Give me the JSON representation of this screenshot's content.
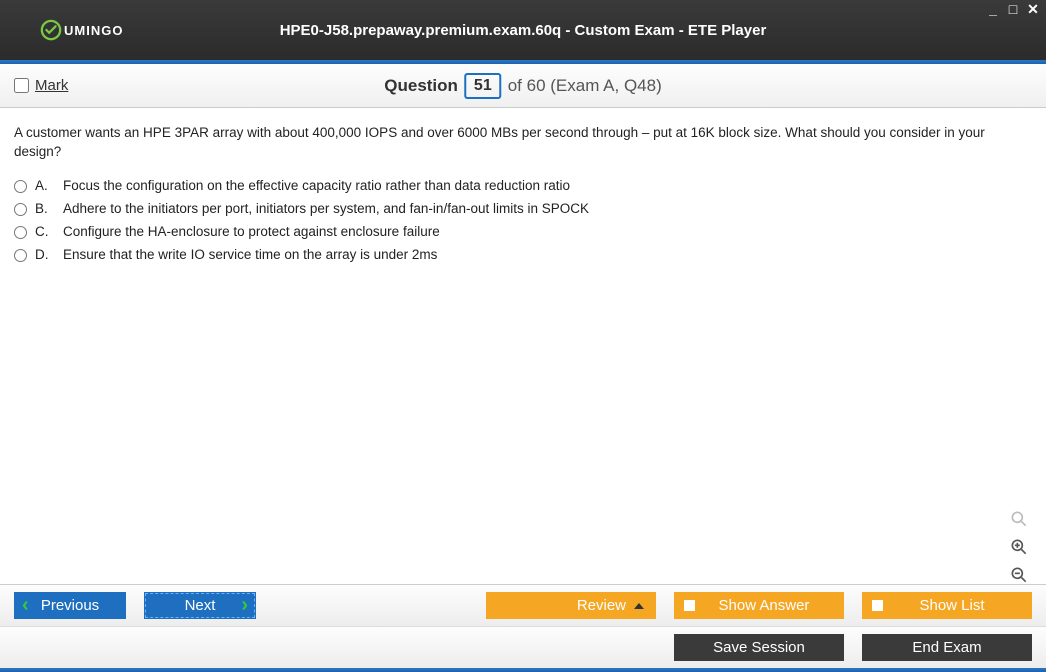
{
  "window": {
    "title": "HPE0-J58.prepaway.premium.exam.60q - Custom Exam - ETE Player",
    "logo_text": "UMINGO"
  },
  "header": {
    "mark_label": "Mark",
    "question_label": "Question",
    "current_number": "51",
    "of_text": "of 60 (Exam A, Q48)"
  },
  "question": {
    "text": "A customer wants an HPE 3PAR array with about 400,000 IOPS and over 6000 MBs per second through – put at 16K block size. What should you consider in your design?",
    "choices": [
      {
        "letter": "A.",
        "text": "Focus the configuration on the effective capacity ratio rather than data reduction ratio"
      },
      {
        "letter": "B.",
        "text": "Adhere to the initiators per port, initiators per system, and fan-in/fan-out limits in SPOCK"
      },
      {
        "letter": "C.",
        "text": "Configure the HA-enclosure to protect against enclosure failure"
      },
      {
        "letter": "D.",
        "text": "Ensure that the write IO service time on the array is under 2ms"
      }
    ]
  },
  "buttons": {
    "previous": "Previous",
    "next": "Next",
    "review": "Review",
    "show_answer": "Show Answer",
    "show_list": "Show List",
    "save_session": "Save Session",
    "end_exam": "End Exam"
  },
  "colors": {
    "accent_blue": "#1f6fc0",
    "accent_orange": "#f5a623",
    "dark": "#3a3a3a"
  }
}
